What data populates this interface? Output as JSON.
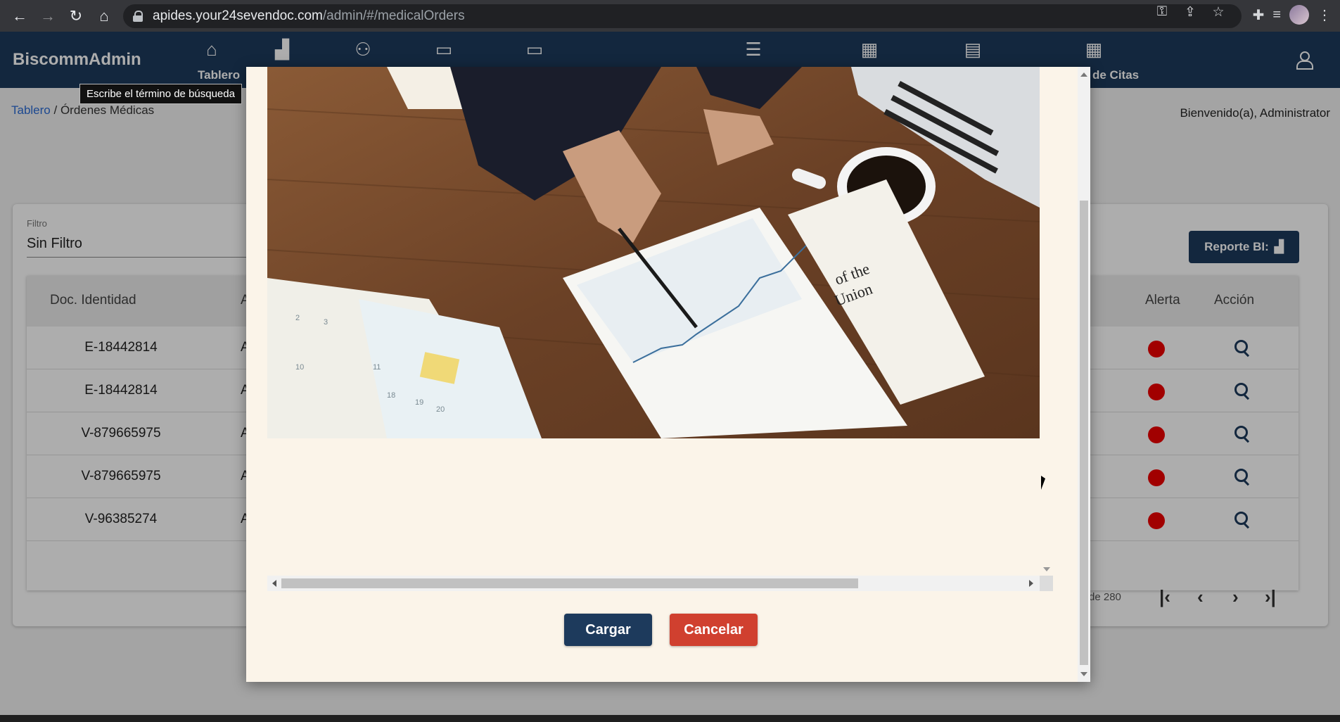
{
  "browser": {
    "url_host": "apides.your24sevendoc.com",
    "url_path": "/admin/#/medicalOrders"
  },
  "app": {
    "brand": "BiscommAdmin",
    "nav_labels": {
      "home": "Tablero",
      "citas": "de Citas"
    },
    "tooltip": "Escribe el término de búsqueda",
    "breadcrumb": {
      "root": "Tablero",
      "separator": " / ",
      "current": "Órdenes Médicas"
    },
    "welcome": "Bienvenido(a), Administrator",
    "filter": {
      "label": "Filtro",
      "value": "Sin Filtro"
    },
    "report_button": "Reporte BI:",
    "table": {
      "headers": {
        "doc": "Doc. Identidad",
        "col2": "A",
        "alert": "Alerta",
        "action": "Acción"
      },
      "rows": [
        {
          "doc": "E-18442814",
          "col2": "A"
        },
        {
          "doc": "E-18442814",
          "col2": "A"
        },
        {
          "doc": "V-879665975",
          "col2": "A"
        },
        {
          "doc": "V-879665975",
          "col2": "A"
        },
        {
          "doc": "V-96385274",
          "col2": "A"
        }
      ],
      "pagination_text": "de 280"
    },
    "alert_color": "#e00000",
    "primary_color": "#1d3a5c"
  },
  "modal": {
    "image_description": "business desk photo",
    "buttons": {
      "load": "Cargar",
      "cancel": "Cancelar"
    },
    "cancel_color": "#d0402f"
  }
}
